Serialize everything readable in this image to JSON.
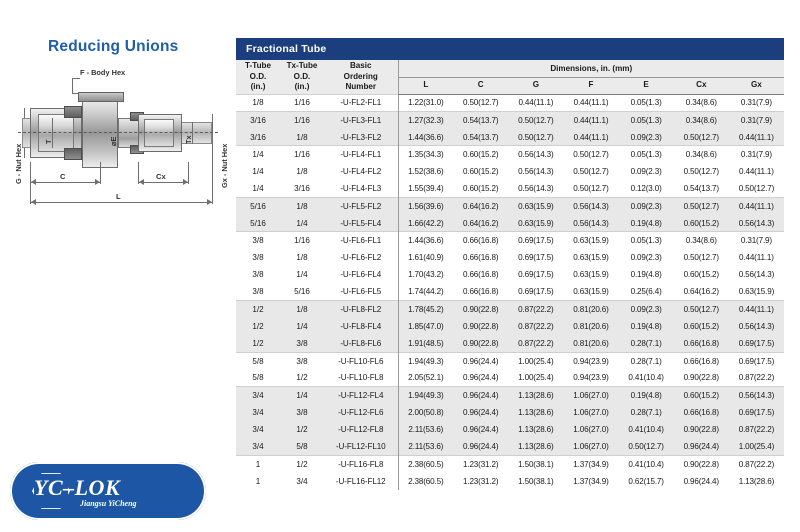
{
  "page": {
    "title": "Reducing Unions",
    "title_color": "#1f5ea8"
  },
  "diagram": {
    "name": "reducing-union-cross-section",
    "callouts": {
      "body_hex": "F - Body Hex",
      "nut_hex_left": "G - Nut Hex",
      "nut_hex_right": "Gx - Nut Hex",
      "tube_left": "T",
      "bore": "⌀E",
      "tube_right": "Tx",
      "dim_c": "C",
      "dim_cx": "Cx",
      "dim_l": "L"
    }
  },
  "logo": {
    "brand": "YC–LOK",
    "company": "Jiangsu YiCheng",
    "color": "#1c56a5"
  },
  "table": {
    "banner": "Fractional Tube",
    "banner_color": "#1a3e7e",
    "headers": {
      "t_tube": [
        "T-Tube",
        "O.D.",
        "(in.)"
      ],
      "tx_tube": [
        "Tx-Tube",
        "O.D.",
        "(in.)"
      ],
      "ordering": [
        "Basic",
        "Ordering",
        "Number"
      ],
      "dimensions_group": "Dimensions, in. (mm)",
      "dims": [
        "L",
        "C",
        "G",
        "F",
        "E",
        "Cx",
        "Gx"
      ]
    },
    "rows": [
      {
        "group": 1,
        "shade": false,
        "t": "1/8",
        "tx": "1/16",
        "ord": "-U-FL2-FL1",
        "L": "1.22(31.0)",
        "C": "0.50(12.7)",
        "G": "0.44(11.1)",
        "F": "0.44(11.1)",
        "E": "0.05(1.3)",
        "Cx": "0.34(8.6)",
        "Gx": "0.31(7.9)"
      },
      {
        "group": 2,
        "shade": true,
        "t": "3/16",
        "tx": "1/16",
        "ord": "-U-FL3-FL1",
        "L": "1.27(32.3)",
        "C": "0.54(13.7)",
        "G": "0.50(12.7)",
        "F": "0.44(11.1)",
        "E": "0.05(1.3)",
        "Cx": "0.34(8.6)",
        "Gx": "0.31(7.9)"
      },
      {
        "group": 2,
        "shade": true,
        "t": "3/16",
        "tx": "1/8",
        "ord": "-U-FL3-FL2",
        "L": "1.44(36.6)",
        "C": "0.54(13.7)",
        "G": "0.50(12.7)",
        "F": "0.44(11.1)",
        "E": "0.09(2.3)",
        "Cx": "0.50(12.7)",
        "Gx": "0.44(11.1)"
      },
      {
        "group": 3,
        "shade": false,
        "t": "1/4",
        "tx": "1/16",
        "ord": "-U-FL4-FL1",
        "L": "1.35(34.3)",
        "C": "0.60(15.2)",
        "G": "0.56(14.3)",
        "F": "0.50(12.7)",
        "E": "0.05(1.3)",
        "Cx": "0.34(8.6)",
        "Gx": "0.31(7.9)"
      },
      {
        "group": 3,
        "shade": false,
        "t": "1/4",
        "tx": "1/8",
        "ord": "-U-FL4-FL2",
        "L": "1.52(38.6)",
        "C": "0.60(15.2)",
        "G": "0.56(14.3)",
        "F": "0.50(12.7)",
        "E": "0.09(2.3)",
        "Cx": "0.50(12.7)",
        "Gx": "0.44(11.1)"
      },
      {
        "group": 3,
        "shade": false,
        "t": "1/4",
        "tx": "3/16",
        "ord": "-U-FL4-FL3",
        "L": "1.55(39.4)",
        "C": "0.60(15.2)",
        "G": "0.56(14.3)",
        "F": "0.50(12.7)",
        "E": "0.12(3.0)",
        "Cx": "0.54(13.7)",
        "Gx": "0.50(12.7)"
      },
      {
        "group": 4,
        "shade": true,
        "t": "5/16",
        "tx": "1/8",
        "ord": "-U-FL5-FL2",
        "L": "1.56(39.6)",
        "C": "0.64(16.2)",
        "G": "0.63(15.9)",
        "F": "0.56(14.3)",
        "E": "0.09(2.3)",
        "Cx": "0.50(12.7)",
        "Gx": "0.44(11.1)"
      },
      {
        "group": 4,
        "shade": true,
        "t": "5/16",
        "tx": "1/4",
        "ord": "-U-FL5-FL4",
        "L": "1.66(42.2)",
        "C": "0.64(16.2)",
        "G": "0.63(15.9)",
        "F": "0.56(14.3)",
        "E": "0.19(4.8)",
        "Cx": "0.60(15.2)",
        "Gx": "0.56(14.3)"
      },
      {
        "group": 5,
        "shade": false,
        "t": "3/8",
        "tx": "1/16",
        "ord": "-U-FL6-FL1",
        "L": "1.44(36.6)",
        "C": "0.66(16.8)",
        "G": "0.69(17.5)",
        "F": "0.63(15.9)",
        "E": "0.05(1.3)",
        "Cx": "0.34(8.6)",
        "Gx": "0.31(7.9)"
      },
      {
        "group": 5,
        "shade": false,
        "t": "3/8",
        "tx": "1/8",
        "ord": "-U-FL6-FL2",
        "L": "1.61(40.9)",
        "C": "0.66(16.8)",
        "G": "0.69(17.5)",
        "F": "0.63(15.9)",
        "E": "0.09(2.3)",
        "Cx": "0.50(12.7)",
        "Gx": "0.44(11.1)"
      },
      {
        "group": 5,
        "shade": false,
        "t": "3/8",
        "tx": "1/4",
        "ord": "-U-FL6-FL4",
        "L": "1.70(43.2)",
        "C": "0.66(16.8)",
        "G": "0.69(17.5)",
        "F": "0.63(15.9)",
        "E": "0.19(4.8)",
        "Cx": "0.60(15.2)",
        "Gx": "0.56(14.3)"
      },
      {
        "group": 5,
        "shade": false,
        "t": "3/8",
        "tx": "5/16",
        "ord": "-U-FL6-FL5",
        "L": "1.74(44.2)",
        "C": "0.66(16.8)",
        "G": "0.69(17.5)",
        "F": "0.63(15.9)",
        "E": "0.25(6.4)",
        "Cx": "0.64(16.2)",
        "Gx": "0.63(15.9)"
      },
      {
        "group": 6,
        "shade": true,
        "t": "1/2",
        "tx": "1/8",
        "ord": "-U-FL8-FL2",
        "L": "1.78(45.2)",
        "C": "0.90(22.8)",
        "G": "0.87(22.2)",
        "F": "0.81(20.6)",
        "E": "0.09(2.3)",
        "Cx": "0.50(12.7)",
        "Gx": "0.44(11.1)"
      },
      {
        "group": 6,
        "shade": true,
        "t": "1/2",
        "tx": "1/4",
        "ord": "-U-FL8-FL4",
        "L": "1.85(47.0)",
        "C": "0.90(22.8)",
        "G": "0.87(22.2)",
        "F": "0.81(20.6)",
        "E": "0.19(4.8)",
        "Cx": "0.60(15.2)",
        "Gx": "0.56(14.3)"
      },
      {
        "group": 6,
        "shade": true,
        "t": "1/2",
        "tx": "3/8",
        "ord": "-U-FL8-FL6",
        "L": "1.91(48.5)",
        "C": "0.90(22.8)",
        "G": "0.87(22.2)",
        "F": "0.81(20.6)",
        "E": "0.28(7.1)",
        "Cx": "0.66(16.8)",
        "Gx": "0.69(17.5)"
      },
      {
        "group": 7,
        "shade": false,
        "t": "5/8",
        "tx": "3/8",
        "ord": "-U-FL10-FL6",
        "L": "1.94(49.3)",
        "C": "0.96(24.4)",
        "G": "1.00(25.4)",
        "F": "0.94(23.9)",
        "E": "0.28(7.1)",
        "Cx": "0.66(16.8)",
        "Gx": "0.69(17.5)"
      },
      {
        "group": 7,
        "shade": false,
        "t": "5/8",
        "tx": "1/2",
        "ord": "-U-FL10-FL8",
        "L": "2.05(52.1)",
        "C": "0.96(24.4)",
        "G": "1.00(25.4)",
        "F": "0.94(23.9)",
        "E": "0.41(10.4)",
        "Cx": "0.90(22.8)",
        "Gx": "0.87(22.2)"
      },
      {
        "group": 8,
        "shade": true,
        "t": "3/4",
        "tx": "1/4",
        "ord": "-U-FL12-FL4",
        "L": "1.94(49.3)",
        "C": "0.96(24.4)",
        "G": "1.13(28.6)",
        "F": "1.06(27.0)",
        "E": "0.19(4.8)",
        "Cx": "0.60(15.2)",
        "Gx": "0.56(14.3)"
      },
      {
        "group": 8,
        "shade": true,
        "t": "3/4",
        "tx": "3/8",
        "ord": "-U-FL12-FL6",
        "L": "2.00(50.8)",
        "C": "0.96(24.4)",
        "G": "1.13(28.6)",
        "F": "1.06(27.0)",
        "E": "0.28(7.1)",
        "Cx": "0.66(16.8)",
        "Gx": "0.69(17.5)"
      },
      {
        "group": 8,
        "shade": true,
        "t": "3/4",
        "tx": "1/2",
        "ord": "-U-FL12-FL8",
        "L": "2.11(53.6)",
        "C": "0.96(24.4)",
        "G": "1.13(28.6)",
        "F": "1.06(27.0)",
        "E": "0.41(10.4)",
        "Cx": "0.90(22.8)",
        "Gx": "0.87(22.2)"
      },
      {
        "group": 8,
        "shade": true,
        "t": "3/4",
        "tx": "5/8",
        "ord": "-U-FL12-FL10",
        "L": "2.11(53.6)",
        "C": "0.96(24.4)",
        "G": "1.13(28.6)",
        "F": "1.06(27.0)",
        "E": "0.50(12.7)",
        "Cx": "0.96(24.4)",
        "Gx": "1.00(25.4)"
      },
      {
        "group": 9,
        "shade": false,
        "t": "1",
        "tx": "1/2",
        "ord": "-U-FL16-FL8",
        "L": "2.38(60.5)",
        "C": "1.23(31.2)",
        "G": "1.50(38.1)",
        "F": "1.37(34.9)",
        "E": "0.41(10.4)",
        "Cx": "0.90(22.8)",
        "Gx": "0.87(22.2)"
      },
      {
        "group": 9,
        "shade": false,
        "t": "1",
        "tx": "3/4",
        "ord": "-U-FL16-FL12",
        "L": "2.38(60.5)",
        "C": "1.23(31.2)",
        "G": "1.50(38.1)",
        "F": "1.37(34.9)",
        "E": "0.62(15.7)",
        "Cx": "0.96(24.4)",
        "Gx": "1.13(28.6)"
      }
    ]
  }
}
